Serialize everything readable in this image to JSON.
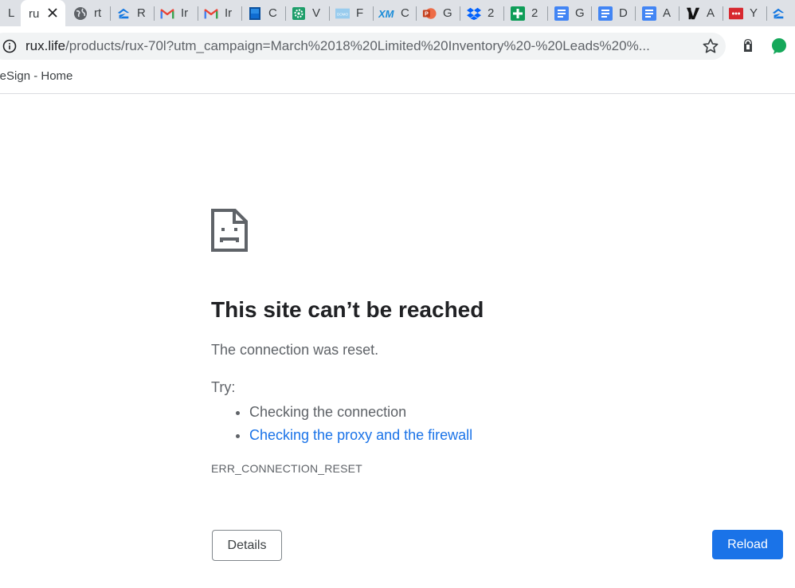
{
  "tabs": [
    {
      "label": "L",
      "favicon": "tab-icon",
      "active": false
    },
    {
      "label": "ru",
      "favicon": "none",
      "active": true
    },
    {
      "label": "rt",
      "favicon": "globe-icon",
      "active": false
    },
    {
      "label": "R",
      "favicon": "zillow-icon",
      "active": false
    },
    {
      "label": "Ir",
      "favicon": "gmail-icon",
      "active": false
    },
    {
      "label": "Ir",
      "favicon": "gmail-icon",
      "active": false
    },
    {
      "label": "C",
      "favicon": "app-blue-icon",
      "active": false
    },
    {
      "label": "V",
      "favicon": "gear-green-icon",
      "active": false
    },
    {
      "label": "F",
      "favicon": "domo-icon",
      "active": false
    },
    {
      "label": "C",
      "favicon": "xm-icon",
      "active": false
    },
    {
      "label": "G",
      "favicon": "powerpoint-icon",
      "active": false
    },
    {
      "label": "2",
      "favicon": "dropbox-icon",
      "active": false
    },
    {
      "label": "2",
      "favicon": "sheets-icon",
      "active": false
    },
    {
      "label": "G",
      "favicon": "docs-icon",
      "active": false
    },
    {
      "label": "D",
      "favicon": "docs-icon",
      "active": false
    },
    {
      "label": "A",
      "favicon": "docs-icon",
      "active": false
    },
    {
      "label": "A",
      "favicon": "vox-icon",
      "active": false
    },
    {
      "label": "Y",
      "favicon": "red-app-icon",
      "active": false
    },
    {
      "label": "",
      "favicon": "zillow-icon",
      "active": false
    }
  ],
  "omnibox": {
    "host": "rux.life",
    "path": "/products/rux-70l?utm_campaign=March%2018%20Limited%20Inventory%20-%20Leads%20%..."
  },
  "bookmarks": [
    {
      "label": "eleSign - Home"
    }
  ],
  "error_page": {
    "title": "This site can’t be reached",
    "message": "The connection was reset.",
    "try_label": "Try:",
    "suggestions": [
      {
        "text": "Checking the connection",
        "is_link": false
      },
      {
        "text": "Checking the proxy and the firewall",
        "is_link": true
      }
    ],
    "error_code": "ERR_CONNECTION_RESET",
    "details_label": "Details",
    "reload_label": "Reload"
  },
  "colors": {
    "tabstrip_bg": "#dee1e6",
    "link": "#1a73e8",
    "reload_bg": "#1a73e8",
    "text_primary": "#202124",
    "text_secondary": "#5f6368"
  }
}
